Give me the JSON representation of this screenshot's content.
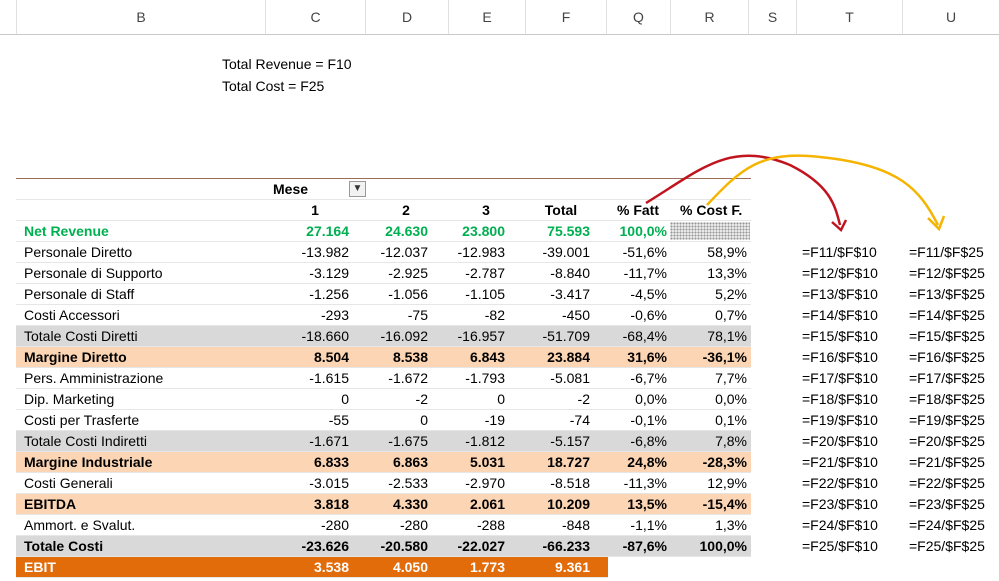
{
  "col_headers": [
    "B",
    "C",
    "D",
    "E",
    "F",
    "Q",
    "R",
    "S",
    "T",
    "U"
  ],
  "notes": [
    "Total Revenue = F10",
    "Total Cost = F25"
  ],
  "pivot": {
    "mese_label": "Mese",
    "headers": [
      "1",
      "2",
      "3",
      "Total",
      "% Fatt",
      "% Cost F."
    ],
    "rows": [
      {
        "label": "Net Revenue",
        "v": [
          "27.164",
          "24.630",
          "23.800",
          "75.593",
          "100,0%",
          ""
        ],
        "style": "green"
      },
      {
        "label": "Personale Diretto",
        "v": [
          "-13.982",
          "-12.037",
          "-12.983",
          "-39.001",
          "-51,6%",
          "58,9%"
        ],
        "style": ""
      },
      {
        "label": "Personale di Supporto",
        "v": [
          "-3.129",
          "-2.925",
          "-2.787",
          "-8.840",
          "-11,7%",
          "13,3%"
        ],
        "style": ""
      },
      {
        "label": "Personale di Staff",
        "v": [
          "-1.256",
          "-1.056",
          "-1.105",
          "-3.417",
          "-4,5%",
          "5,2%"
        ],
        "style": ""
      },
      {
        "label": "Costi Accessori",
        "v": [
          "-293",
          "-75",
          "-82",
          "-450",
          "-0,6%",
          "0,7%"
        ],
        "style": ""
      },
      {
        "label": "Totale Costi Diretti",
        "v": [
          "-18.660",
          "-16.092",
          "-16.957",
          "-51.709",
          "-68,4%",
          "78,1%"
        ],
        "style": "gray"
      },
      {
        "label": "Margine Diretto",
        "v": [
          "8.504",
          "8.538",
          "6.843",
          "23.884",
          "31,6%",
          "-36,1%"
        ],
        "style": "peach"
      },
      {
        "label": "Pers. Amministrazione",
        "v": [
          "-1.615",
          "-1.672",
          "-1.793",
          "-5.081",
          "-6,7%",
          "7,7%"
        ],
        "style": ""
      },
      {
        "label": "Dip. Marketing",
        "v": [
          "0",
          "-2",
          "0",
          "-2",
          "0,0%",
          "0,0%"
        ],
        "style": ""
      },
      {
        "label": "Costi per Trasferte",
        "v": [
          "-55",
          "0",
          "-19",
          "-74",
          "-0,1%",
          "0,1%"
        ],
        "style": ""
      },
      {
        "label": "Totale Costi Indiretti",
        "v": [
          "-1.671",
          "-1.675",
          "-1.812",
          "-5.157",
          "-6,8%",
          "7,8%"
        ],
        "style": "gray"
      },
      {
        "label": "Margine Industriale",
        "v": [
          "6.833",
          "6.863",
          "5.031",
          "18.727",
          "24,8%",
          "-28,3%"
        ],
        "style": "peach"
      },
      {
        "label": "Costi Generali",
        "v": [
          "-3.015",
          "-2.533",
          "-2.970",
          "-8.518",
          "-11,3%",
          "12,9%"
        ],
        "style": ""
      },
      {
        "label": "EBITDA",
        "v": [
          "3.818",
          "4.330",
          "2.061",
          "10.209",
          "13,5%",
          "-15,4%"
        ],
        "style": "peach"
      },
      {
        "label": "Ammort. e Svalut.",
        "v": [
          "-280",
          "-280",
          "-288",
          "-848",
          "-1,1%",
          "1,3%"
        ],
        "style": ""
      },
      {
        "label": "Totale Costi",
        "v": [
          "-23.626",
          "-20.580",
          "-22.027",
          "-66.233",
          "-87,6%",
          "100,0%"
        ],
        "style": "gray"
      },
      {
        "label": "EBIT",
        "v": [
          "3.538",
          "4.050",
          "1.773",
          "9.361",
          "",
          ""
        ],
        "style": "orange"
      }
    ]
  },
  "formulas_t": [
    "=F11/$F$10",
    "=F12/$F$10",
    "=F13/$F$10",
    "=F14/$F$10",
    "=F15/$F$10",
    "=F16/$F$10",
    "=F17/$F$10",
    "=F18/$F$10",
    "=F19/$F$10",
    "=F20/$F$10",
    "=F21/$F$10",
    "=F22/$F$10",
    "=F23/$F$10",
    "=F24/$F$10",
    "=F25/$F$10"
  ],
  "formulas_u": [
    "=F11/$F$25",
    "=F12/$F$25",
    "=F13/$F$25",
    "=F14/$F$25",
    "=F15/$F$25",
    "=F16/$F$25",
    "=F17/$F$25",
    "=F18/$F$25",
    "=F19/$F$25",
    "=F20/$F$25",
    "=F21/$F$25",
    "=F22/$F$25",
    "=F23/$F$25",
    "=F24/$F$25",
    "=F25/$F$25"
  ],
  "colors": {
    "green": "#00b050",
    "gray": "#d9d9d9",
    "peach": "#fcd5b4",
    "orange": "#e26b0a",
    "red_arrow": "#c0141e",
    "yellow_arrow": "#f5b400"
  }
}
